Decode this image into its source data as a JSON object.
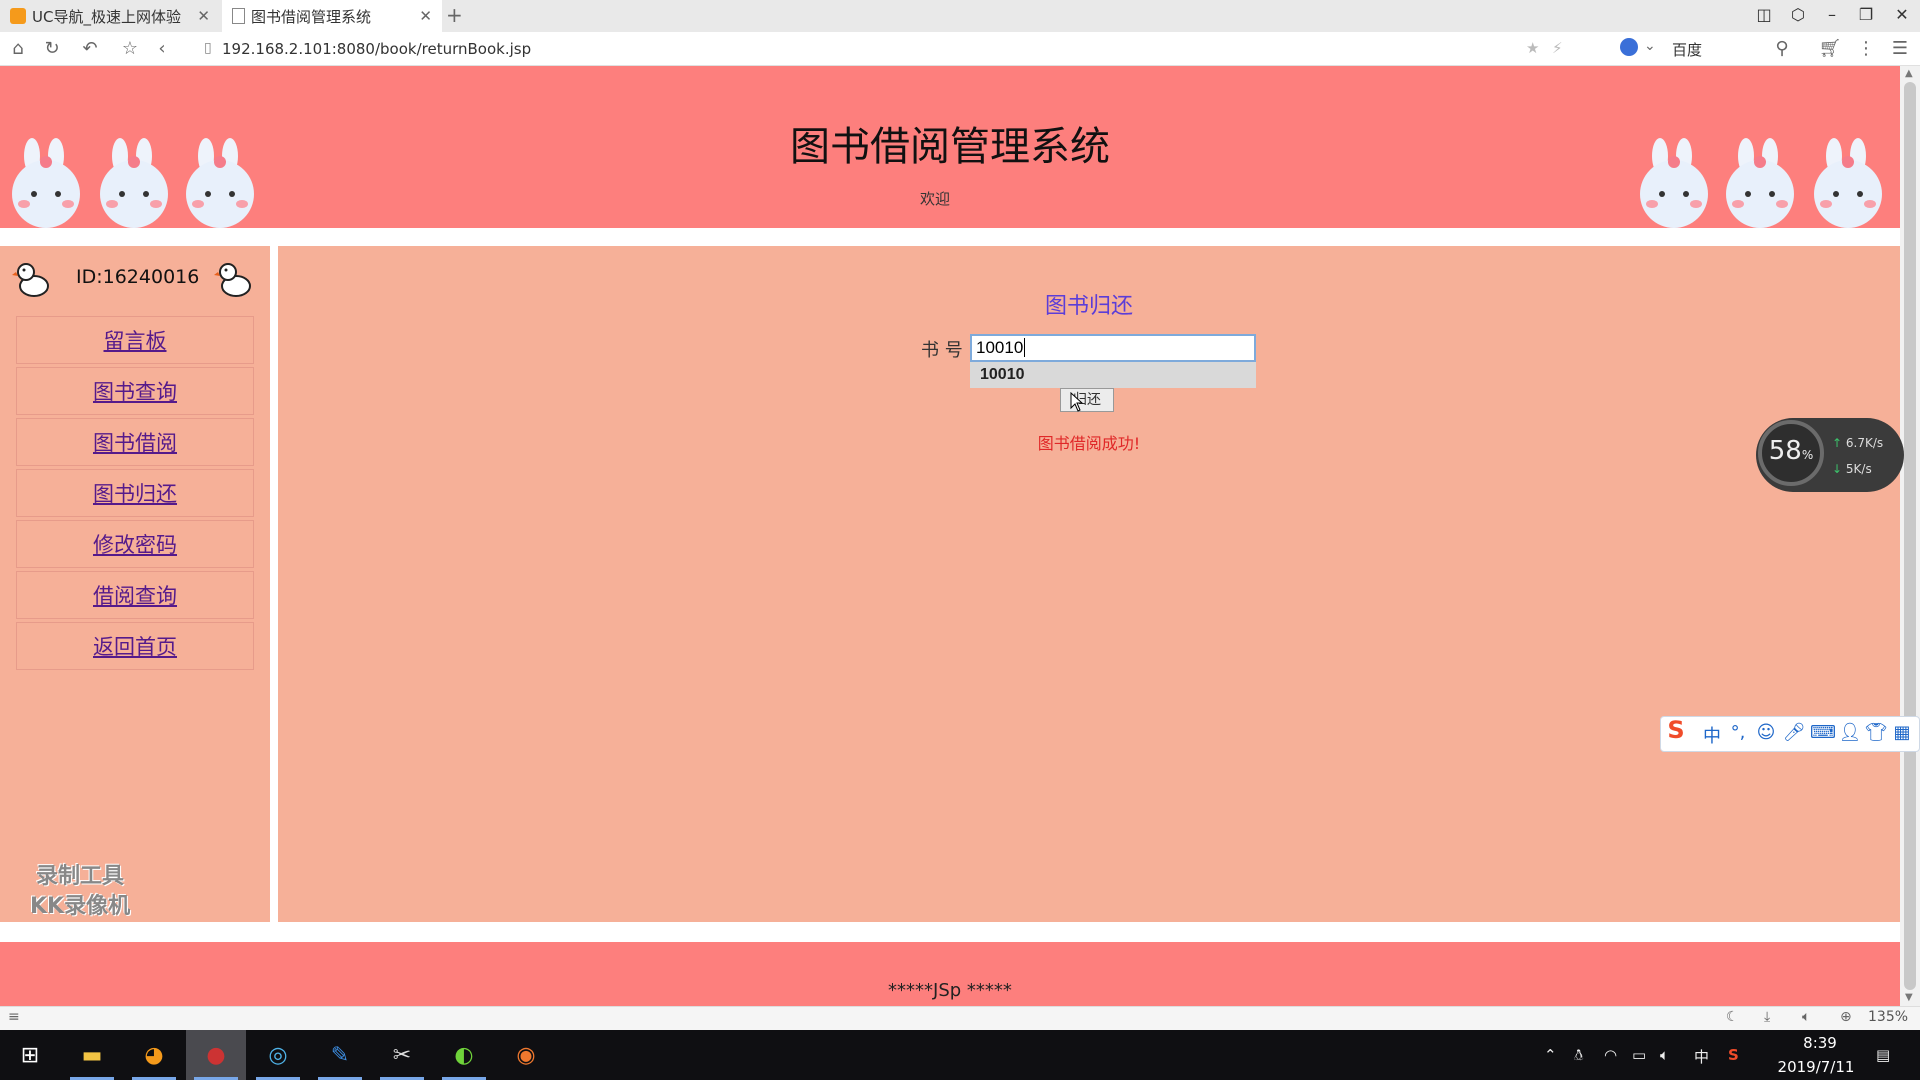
{
  "browser": {
    "tabs": [
      {
        "label": "UC导航_极速上网体验",
        "active": false
      },
      {
        "label": "图书借阅管理系统",
        "active": true
      }
    ],
    "new_tab": "+",
    "url": "192.168.2.101:8080/book/returnBook.jsp",
    "search_engine": "百度",
    "zoom": "135%"
  },
  "header": {
    "title": "图书借阅管理系统",
    "welcome": "欢迎"
  },
  "sidebar": {
    "user_id": "ID:16240016",
    "items": [
      {
        "label": "留言板"
      },
      {
        "label": "图书查询"
      },
      {
        "label": "图书借阅"
      },
      {
        "label": "图书归还"
      },
      {
        "label": "修改密码"
      },
      {
        "label": "借阅查询"
      },
      {
        "label": "返回首页"
      }
    ]
  },
  "main": {
    "form_title": "图书归还",
    "isbn_label": "书 号",
    "isbn_value": "10010",
    "autocomplete_suggestion": "10010",
    "return_button": "归还",
    "message": "图书借阅成功!"
  },
  "footer": {
    "text": "*****JSp *****"
  },
  "watermark": {
    "line1": "录制工具",
    "line2": "KK录像机"
  },
  "net_monitor": {
    "cpu": "58",
    "cpu_unit": "%",
    "upload": "6.7K/s",
    "download": "5K/s"
  },
  "ime": {
    "mode": "中"
  },
  "taskbar": {
    "time": "8:39",
    "date": "2019/7/11",
    "lang": "中"
  },
  "colors": {
    "header_bg": "#fd7f7d",
    "panel_bg": "#f6b098",
    "link": "#551a8b",
    "title": "#5b3dd8",
    "success": "#e02828"
  }
}
